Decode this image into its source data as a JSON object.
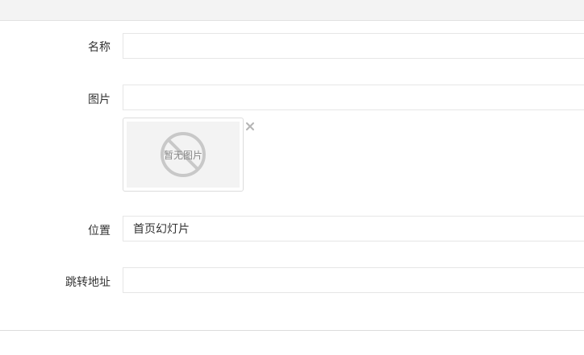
{
  "form": {
    "name": {
      "label": "名称",
      "value": ""
    },
    "image": {
      "label": "图片",
      "value": "",
      "placeholder_text": "暂无图片",
      "placeholder_icon": "no-image-icon",
      "remove_icon": "close-icon"
    },
    "position": {
      "label": "位置",
      "value": "首页幻灯片"
    },
    "redirect_url": {
      "label": "跳转地址",
      "value": ""
    }
  },
  "colors": {
    "topbar": "#f3f3f3",
    "border": "#e6e6e6",
    "label_text": "#333333",
    "placeholder_grey": "#c8c8c8"
  }
}
